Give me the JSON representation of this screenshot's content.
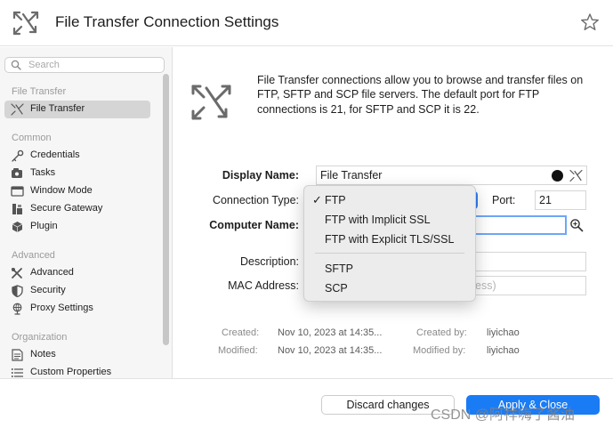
{
  "header": {
    "title": "File Transfer Connection Settings",
    "icon": "file-transfer-icon",
    "favorite_icon": "star-icon"
  },
  "sidebar": {
    "search_placeholder": "Search",
    "groups": {
      "file_transfer": "File Transfer",
      "common": "Common",
      "advanced": "Advanced",
      "organization": "Organization"
    },
    "items": [
      {
        "label": "File Transfer",
        "icon": "file-transfer-icon",
        "selected": true
      },
      {
        "label": "Credentials",
        "icon": "key-icon"
      },
      {
        "label": "Tasks",
        "icon": "tasks-icon"
      },
      {
        "label": "Window Mode",
        "icon": "window-icon"
      },
      {
        "label": "Secure Gateway",
        "icon": "gateway-icon"
      },
      {
        "label": "Plugin",
        "icon": "plugin-icon"
      },
      {
        "label": "Advanced",
        "icon": "tools-icon"
      },
      {
        "label": "Security",
        "icon": "shield-icon"
      },
      {
        "label": "Proxy Settings",
        "icon": "proxy-icon"
      },
      {
        "label": "Notes",
        "icon": "notes-icon"
      },
      {
        "label": "Custom Properties",
        "icon": "list-icon"
      }
    ]
  },
  "main": {
    "description": "File Transfer connections allow you to browse and transfer files on FTP, SFTP and SCP file servers. The default port for FTP connections is 21, for SFTP and SCP it is 22.",
    "labels": {
      "display_name": "Display Name:",
      "connection_type": "Connection Type:",
      "port": "Port:",
      "computer_name": "Computer Name:",
      "description": "Description:",
      "mac_address": "MAC Address:"
    },
    "values": {
      "display_name": "File Transfer",
      "port": "21",
      "mac_address_placeholder_tail": "ess)"
    },
    "meta": {
      "created_label": "Created:",
      "created_value": "Nov 10, 2023 at 14:35...",
      "created_by_label": "Created by:",
      "created_by_value": "liyichao",
      "modified_label": "Modified:",
      "modified_value": "Nov 10, 2023 at 14:35...",
      "modified_by_label": "Modified by:",
      "modified_by_value": "liyichao"
    }
  },
  "dropdown": {
    "selected": "FTP",
    "checkmark": "✓",
    "options": [
      "FTP",
      "FTP with Implicit SSL",
      "FTP with Explicit TLS/SSL",
      "SFTP",
      "SCP"
    ]
  },
  "footer": {
    "discard_label": "Discard changes",
    "apply_label": "Apply & Close"
  },
  "watermark": "CSDN @阿祥嗨了酱油",
  "colors": {
    "accent": "#1a7cf5",
    "selection": "#d5d5d5",
    "sidebar_bg": "#f6f6f6"
  }
}
